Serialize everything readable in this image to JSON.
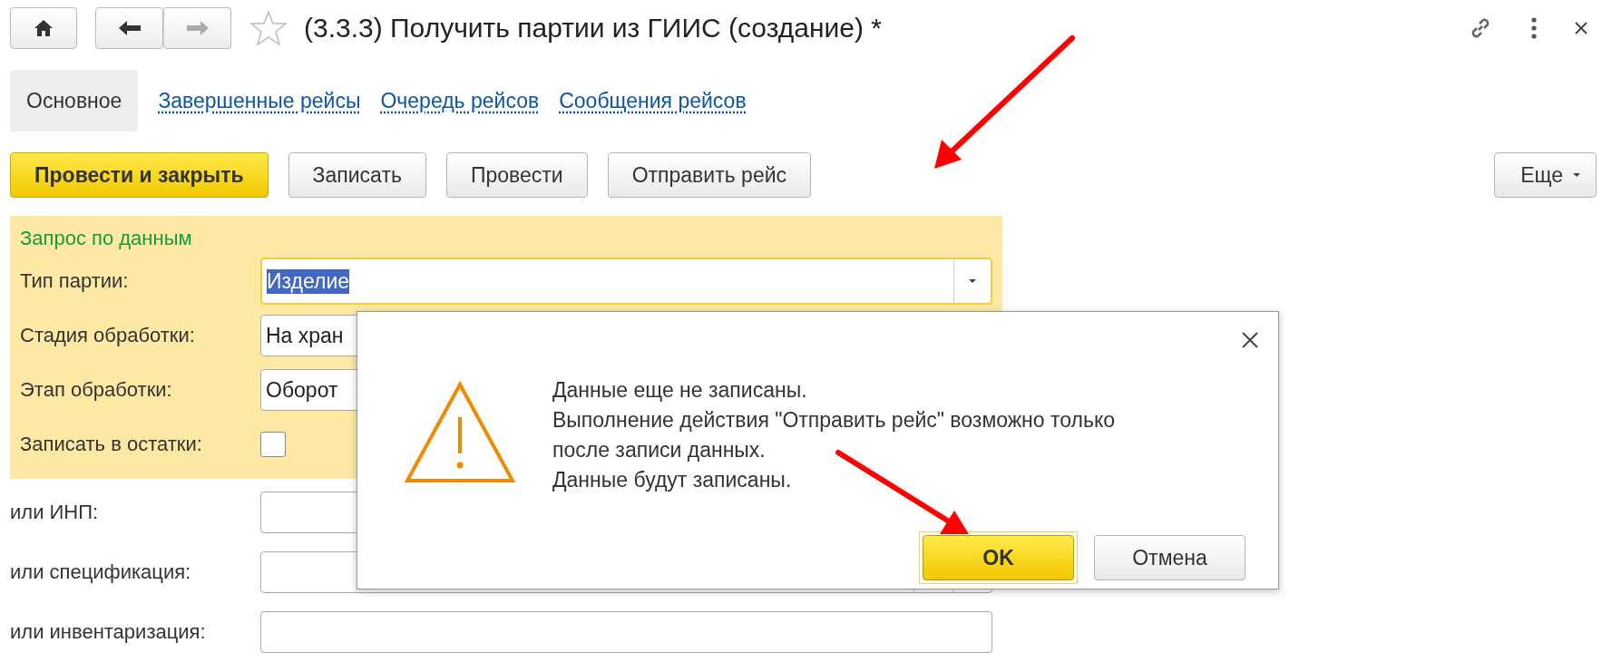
{
  "title": "(3.3.3) Получить партии из ГИИС (создание) *",
  "tabs": [
    {
      "label": "Основное",
      "selected": true
    },
    {
      "label": "Завершенные рейсы",
      "selected": false
    },
    {
      "label": "Очередь рейсов",
      "selected": false
    },
    {
      "label": "Сообщения рейсов",
      "selected": false
    }
  ],
  "toolbar": {
    "buttons": [
      {
        "label": "Провести и закрыть",
        "kind": "primary"
      },
      {
        "label": "Записать",
        "kind": "normal"
      },
      {
        "label": "Провести",
        "kind": "normal"
      },
      {
        "label": "Отправить рейс",
        "kind": "normal"
      }
    ],
    "more": "Еще"
  },
  "group": {
    "title": "Запрос по данным",
    "fields": [
      {
        "label": "Тип партии:",
        "kind": "select",
        "value": "Изделие",
        "focused": true
      },
      {
        "label": "Стадия обработки:",
        "kind": "text",
        "value": "На хран"
      },
      {
        "label": "Этап обработки:",
        "kind": "text",
        "value": "Оборот"
      },
      {
        "label": "Записать в остатки:",
        "kind": "checkbox",
        "checked": false
      }
    ]
  },
  "fields": [
    {
      "label": "или ИНП:",
      "kind": "text"
    },
    {
      "label": "или спецификация:",
      "kind": "choice"
    },
    {
      "label": "или инвентаризация:",
      "kind": "text"
    }
  ],
  "dialog": {
    "lines": [
      "Данные еще не записаны.",
      "Выполнение действия \"Отправить рейс\" возможно только",
      "после записи данных.",
      "Данные будут записаны."
    ],
    "buttons": [
      {
        "label": "OK",
        "kind": "default"
      },
      {
        "label": "Отмена",
        "kind": "normal"
      }
    ]
  }
}
